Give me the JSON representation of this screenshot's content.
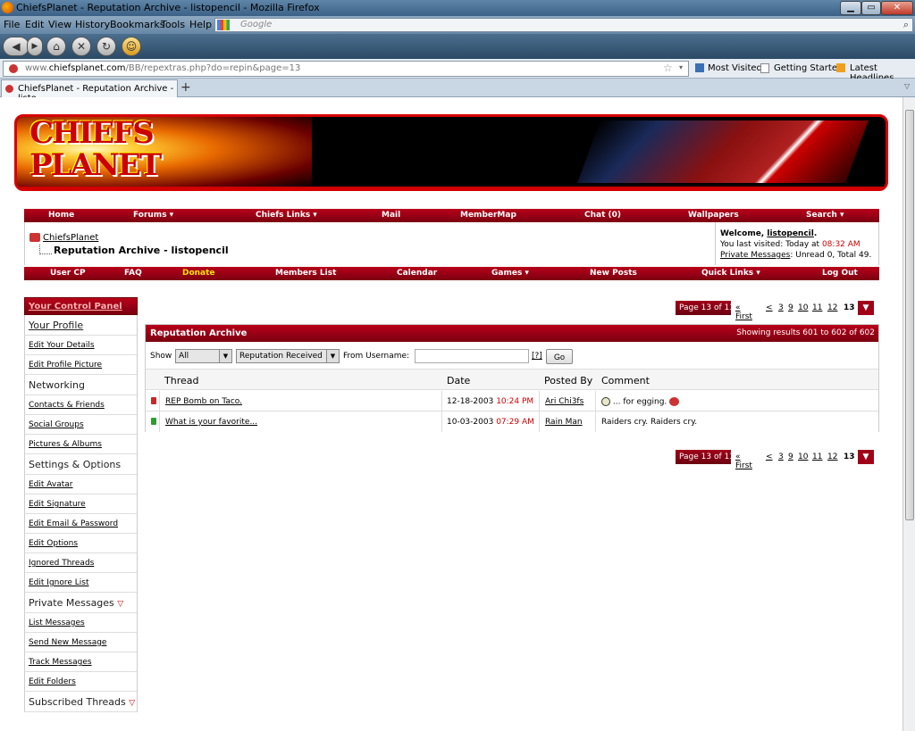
{
  "browser": {
    "window_title": "ChiefsPlanet - Reputation Archive - listopencil - Mozilla Firefox",
    "menu": [
      "File",
      "Edit",
      "View",
      "History",
      "Bookmarks",
      "Tools",
      "Help"
    ],
    "search_placeholder": "Google",
    "url_prefix": "www.",
    "url_domain": "chiefsplanet.com",
    "url_path": "/BB/repextras.php?do=repin&page=13",
    "bookmarks": [
      "Most Visited",
      "Getting Started",
      "Latest Headlines"
    ],
    "tab_title": "ChiefsPlanet - Reputation Archive - listo...",
    "new_tab": "+"
  },
  "site": {
    "logo_line1": "CHIEFS",
    "logo_line2": "PLANET",
    "nav_top": [
      "Home",
      "Forums ▾",
      "Chiefs Links ▾",
      "Mail",
      "MemberMap",
      "Chat (0)",
      "Wallpapers",
      "Search ▾"
    ],
    "nav_bottom": [
      "User CP",
      "FAQ",
      "Donate",
      "Members List",
      "Calendar",
      "Games ▾",
      "New Posts",
      "Quick Links ▾",
      "Log Out"
    ],
    "breadcrumb_home": "ChiefsPlanet",
    "page_title": "Reputation Archive - listopencil",
    "welcome": {
      "prefix": "Welcome, ",
      "username": "listopencil",
      "suffix": ".",
      "last_visited_prefix": "You last visited: Today at ",
      "last_visited_time": "08:32 AM",
      "pm_link": "Private Messages",
      "pm_suffix": ": Unread 0, Total 49."
    }
  },
  "sidebar": {
    "header": "Your Control Panel",
    "items": [
      {
        "type": "section",
        "label": "Your Profile",
        "link": true
      },
      {
        "type": "link",
        "label": "Edit Your Details"
      },
      {
        "type": "link",
        "label": "Edit Profile Picture"
      },
      {
        "type": "section",
        "label": "Networking"
      },
      {
        "type": "link",
        "label": "Contacts & Friends"
      },
      {
        "type": "link",
        "label": "Social Groups"
      },
      {
        "type": "link",
        "label": "Pictures & Albums"
      },
      {
        "type": "section",
        "label": "Settings & Options"
      },
      {
        "type": "link",
        "label": "Edit Avatar"
      },
      {
        "type": "link",
        "label": "Edit Signature"
      },
      {
        "type": "link",
        "label": "Edit Email & Password"
      },
      {
        "type": "link",
        "label": "Edit Options"
      },
      {
        "type": "link",
        "label": "Ignored Threads"
      },
      {
        "type": "link",
        "label": "Edit Ignore List"
      },
      {
        "type": "section",
        "label": "Private Messages",
        "collapse": true
      },
      {
        "type": "link",
        "label": "List Messages"
      },
      {
        "type": "link",
        "label": "Send New Message"
      },
      {
        "type": "link",
        "label": "Track Messages"
      },
      {
        "type": "link",
        "label": "Edit Folders"
      },
      {
        "type": "section",
        "label": "Subscribed Threads",
        "collapse": true
      }
    ]
  },
  "pager": {
    "label": "Page 13 of 13",
    "first": "« First",
    "prev": "<",
    "pages": [
      "3",
      "9",
      "10",
      "11",
      "12"
    ],
    "current": "13"
  },
  "archive": {
    "title": "Reputation Archive",
    "results": "Showing results 601 to 602 of 602",
    "show_label": "Show",
    "show_value": "All",
    "type_value": "Reputation Received",
    "from_label": "From Username:",
    "from_value": "",
    "help": "[?]",
    "go": "Go",
    "columns": [
      "Thread",
      "Date",
      "Posted By",
      "Comment"
    ],
    "rows": [
      {
        "status_color": "#c62828",
        "thread": "REP Bomb on Taco.",
        "date": "12-18-2003",
        "time": "10:24 PM",
        "posted_by": "Ari Chi3fs",
        "comment": "... for egging."
      },
      {
        "status_color": "#2e9d2e",
        "thread": "What is your favorite...",
        "date": "10-03-2003",
        "time": "07:29 AM",
        "posted_by": "Rain Man",
        "comment": "Raiders cry. Raiders cry."
      }
    ]
  }
}
